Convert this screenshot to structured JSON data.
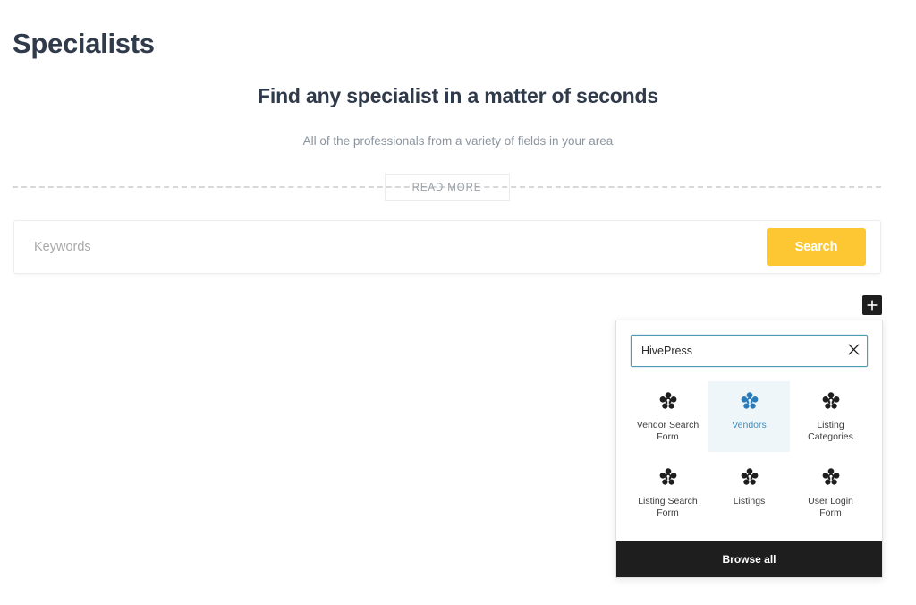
{
  "page": {
    "title": "Specialists"
  },
  "hero": {
    "heading": "Find any specialist in a matter of seconds",
    "subheading": "All of the professionals from a variety of fields in your area",
    "read_more_label": "READ MORE"
  },
  "search_form": {
    "keywords_placeholder": "Keywords",
    "keywords_value": "",
    "submit_label": "Search",
    "submit_color": "#fdc734"
  },
  "editor": {
    "add_block_label": "+",
    "add_block_icon": "plus-icon"
  },
  "inserter": {
    "search_value": "HivePress",
    "search_placeholder": "Search",
    "clear_icon": "close-icon",
    "browse_all_label": "Browse all",
    "selected_block": "Vendors",
    "highlight_color": "#2b7bb9",
    "blocks": [
      {
        "label": "Vendor Search Form",
        "icon": "hivepress-icon",
        "selected": false
      },
      {
        "label": "Vendors",
        "icon": "hivepress-icon",
        "selected": true
      },
      {
        "label": "Listing Categories",
        "icon": "hivepress-icon",
        "selected": false
      },
      {
        "label": "Listing Search Form",
        "icon": "hivepress-icon",
        "selected": false
      },
      {
        "label": "Listings",
        "icon": "hivepress-icon",
        "selected": false
      },
      {
        "label": "User Login Form",
        "icon": "hivepress-icon",
        "selected": false
      }
    ]
  }
}
